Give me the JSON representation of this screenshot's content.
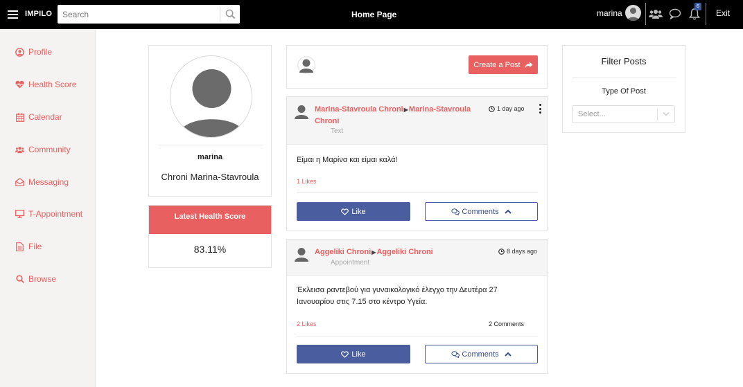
{
  "app": {
    "brand": "IMPILO",
    "page_title": "Home Page"
  },
  "search": {
    "placeholder": "Search",
    "value": ""
  },
  "header": {
    "user_name": "marina",
    "notification_count": "6",
    "exit_label": "Exit"
  },
  "sidebar": {
    "items": [
      {
        "label": "Profile",
        "icon": "user-circle-icon"
      },
      {
        "label": "Health Score",
        "icon": "heartbeat-icon"
      },
      {
        "label": "Calendar",
        "icon": "calendar-icon"
      },
      {
        "label": "Community",
        "icon": "users-icon"
      },
      {
        "label": "Messaging",
        "icon": "envelope-open-icon"
      },
      {
        "label": "T-Appointment",
        "icon": "monitor-icon"
      },
      {
        "label": "File",
        "icon": "file-icon"
      },
      {
        "label": "Browse",
        "icon": "search-icon"
      }
    ]
  },
  "profile": {
    "username": "marina",
    "full_name": "Chroni Marina-Stavroula"
  },
  "health": {
    "heading": "Latest Health Score",
    "value": "83.11%"
  },
  "create_post": {
    "label": "Create a Post"
  },
  "posts": [
    {
      "author": "Marina-Stavroula Chroni",
      "recipient": "Marina-Stavroula Chroni",
      "type": "Text",
      "time": "1 day ago",
      "body": "Είμαι η Μαρίνα και είμαι καλά!",
      "likes": "1 Likes",
      "comments": "",
      "like_label": "Like",
      "comments_label": "Comments"
    },
    {
      "author": "Aggeliki Chroni",
      "recipient": "Aggeliki Chroni",
      "type": "Appointment",
      "time": "8 days ago",
      "body": "Έκλεισα ραντεβού για γυναικολογικό έλεγχο την Δευτέρα 27 Ιανουαρίου στις 7.15 στο κέντρο Υγεία.",
      "likes": "2 Likes",
      "comments": "2 Comments",
      "like_label": "Like",
      "comments_label": "Comments"
    }
  ],
  "filter": {
    "title": "Filter Posts",
    "type_label": "Type Of Post",
    "select_value": "Select..."
  },
  "colors": {
    "accent": "#e8605f",
    "primary": "#4a5d9e",
    "topbar": "#000000"
  }
}
